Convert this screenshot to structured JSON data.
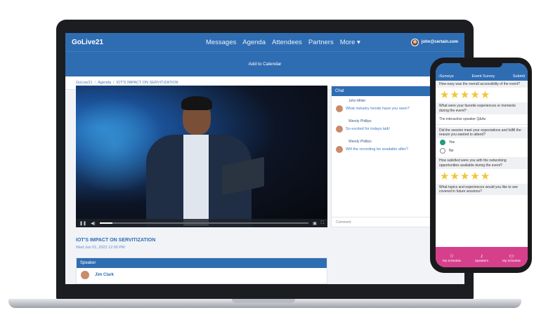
{
  "nav": {
    "brand": "GoLive21",
    "links": [
      "Messages",
      "Agenda",
      "Attendees",
      "Partners",
      "More"
    ],
    "user_email": "john@certain.com"
  },
  "calendar_label": "Add to Calendar",
  "breadcrumb": [
    "GoLive21",
    "Agenda",
    "IOT'S IMPACT ON SERVITIZATION"
  ],
  "video": {
    "progress_fraction": 0.06
  },
  "chat": {
    "title": "Chat",
    "messages": [
      {
        "name": "John Miller",
        "text": "What industry trends have you seen?"
      },
      {
        "name": "Wendy Phillips",
        "text": "So excited for todays talk!"
      },
      {
        "name": "Wendy Phillips",
        "text": "Will the recording be available after?"
      }
    ],
    "comment_placeholder": "Comment"
  },
  "session": {
    "title": "IOT'S IMPACT ON SERVITIZATION",
    "date": "Wed Jun 01, 2022 12:00 PM",
    "speaker_header": "Speaker",
    "speaker_name": "Jim Clark"
  },
  "phone": {
    "back_label": "Surveys",
    "title": "Event Survey",
    "submit_label": "Submit",
    "q1": "How easy was the overall accessibility of the event?",
    "q1_rating": 5,
    "q2": "What were your favorite experiences or moments during the event?",
    "q2_answer": "The interactive speaker Q&As",
    "q3": "Did the session meet your expectations and fulfill the reason you wanted to attend?",
    "q3_options": [
      "Yes",
      "No"
    ],
    "q3_selected": "Yes",
    "q4": "How satisfied were you with the networking opportunities available during the event?",
    "q4_rating": 5,
    "q5": "What topics and experiences would you like to see covered in future sessions?",
    "tabs": [
      "My Schedule",
      "Speakers",
      "My Schedule"
    ],
    "accent": "#d63f8c"
  },
  "colors": {
    "primary": "#2f6db3"
  }
}
